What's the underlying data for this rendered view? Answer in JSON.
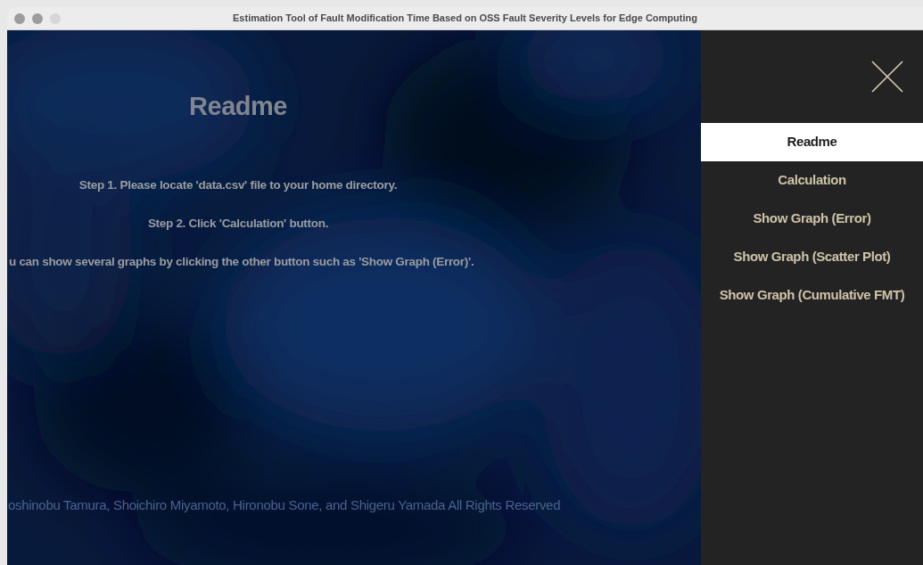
{
  "window": {
    "title": "Estimation Tool of Fault Modification Time Based on OSS Fault Severity Levels for Edge Computing"
  },
  "readme": {
    "heading": "Readme",
    "lines": [
      "Step 1. Please locate 'data.csv' file to your home directory.",
      "Step 2. Click 'Calculation' button.",
      "u can show several graphs by clicking the other button such as 'Show Graph (Error)'."
    ],
    "footer": "oshinobu Tamura, Shoichiro Miyamoto, Hironobu Sone, and Shigeru Yamada All Rights Reserved"
  },
  "sidebar": {
    "items": [
      {
        "label": "Readme",
        "selected": true
      },
      {
        "label": "Calculation",
        "selected": false
      },
      {
        "label": "Show Graph (Error)",
        "selected": false
      },
      {
        "label": "Show Graph (Scatter Plot)",
        "selected": false
      },
      {
        "label": "Show Graph (Cumulative FMT)",
        "selected": false
      }
    ]
  }
}
